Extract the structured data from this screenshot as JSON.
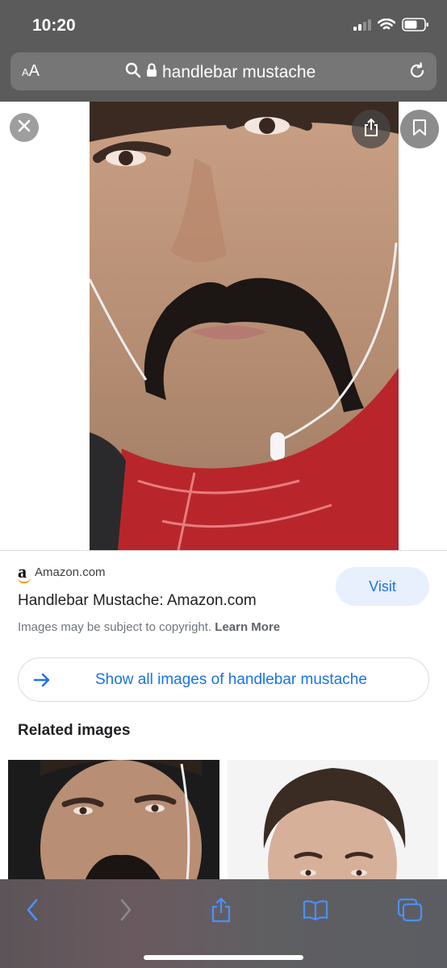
{
  "status_bar": {
    "time": "10:20"
  },
  "address_bar": {
    "text_size_label_small": "A",
    "text_size_label_large": "A",
    "query": "handlebar mustache"
  },
  "result": {
    "source_logo": "a",
    "source_name": "Amazon.com",
    "title": "Handlebar Mustache: Amazon.com",
    "visit_label": "Visit",
    "copyright_text": "Images may be subject to copyright.",
    "learn_more_label": "Learn More",
    "show_all_label": "Show all images of handlebar mustache"
  },
  "related": {
    "heading": "Related images"
  },
  "icons": {
    "search": "search-icon",
    "lock": "lock-icon",
    "reload": "reload-icon",
    "close": "close-icon",
    "share": "share-icon",
    "save": "bookmark-icon",
    "back": "back-icon",
    "forward": "forward-icon",
    "bookmarks": "bookmarks-icon",
    "tabs": "tabs-icon"
  },
  "colors": {
    "accent": "#1a73e8",
    "visit_bg": "#e8f0fe",
    "toolbar_icon": "#4a90ff"
  }
}
